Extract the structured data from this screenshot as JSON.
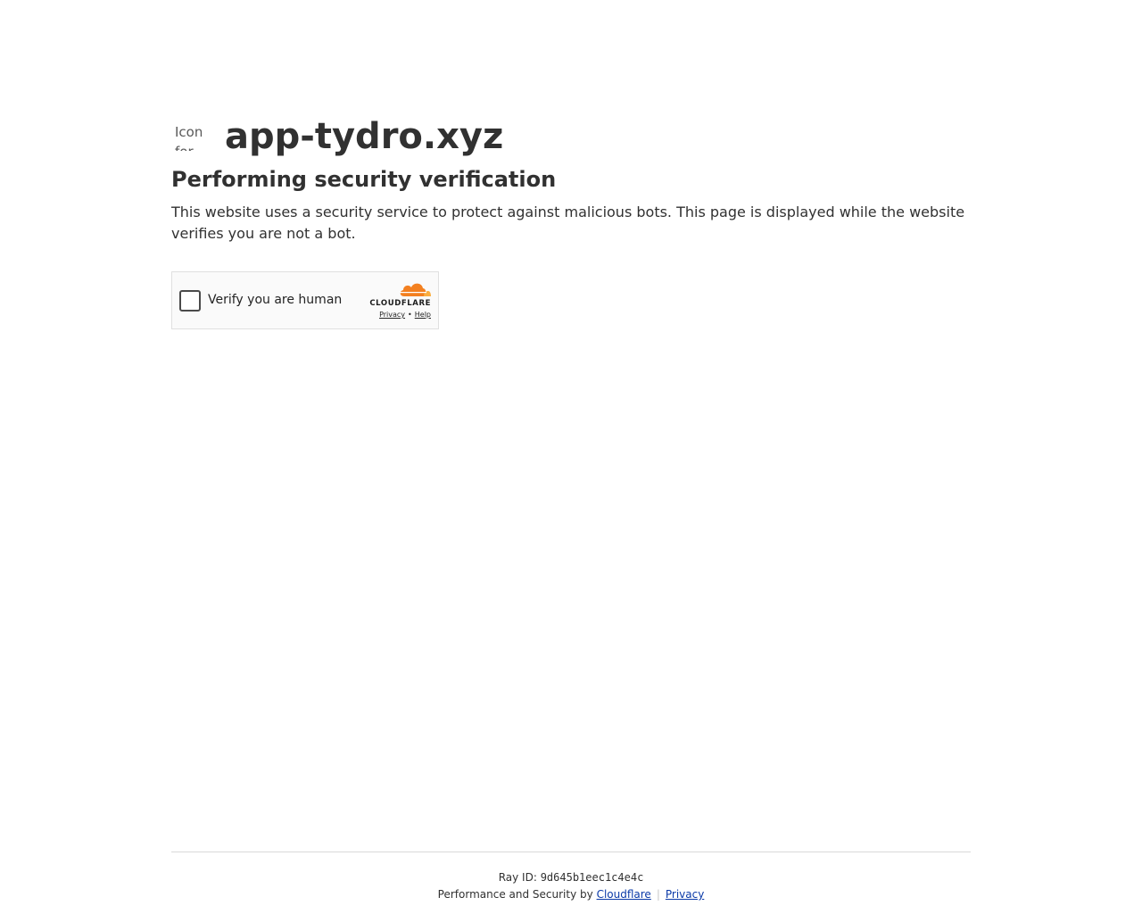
{
  "site": {
    "favicon_alt": "Icon for app-tydro.xyz",
    "name": "app-tydro.xyz"
  },
  "main": {
    "heading": "Performing security verification",
    "description": "This website uses a security service to protect against malicious bots. This page is displayed while the website verifies you are not a bot."
  },
  "widget": {
    "checkbox_label": "Verify you are human",
    "brand": "CLOUDFLARE",
    "privacy_link": "Privacy",
    "separator": "•",
    "help_link": "Help",
    "colors": {
      "cloud_orange": "#f38020",
      "cloud_light": "#faae40"
    }
  },
  "footer": {
    "ray_label": "Ray ID:",
    "ray_id": "9d645b1eec1c4e4c",
    "perf_text": "Performance and Security by",
    "cloudflare_link": "Cloudflare",
    "divider": "|",
    "privacy_link": "Privacy",
    "link_color": "#0b3aa8"
  }
}
